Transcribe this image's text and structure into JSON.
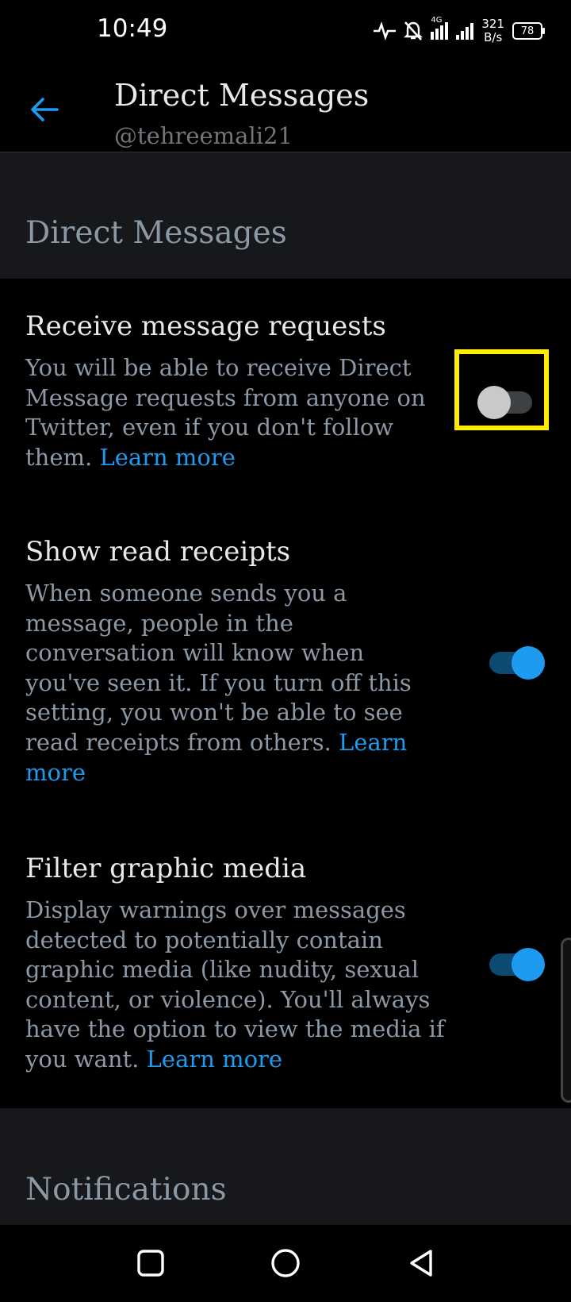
{
  "status_bar": {
    "time": "10:49",
    "net_speed_value": "321",
    "net_speed_unit": "B/s",
    "network_type": "4G",
    "battery": "78",
    "icons": [
      "activity-icon",
      "bell-off-icon",
      "signal-4g-icon",
      "signal-icon",
      "battery-icon"
    ]
  },
  "header": {
    "back_icon": "arrow-left-icon",
    "title": "Direct Messages",
    "subtitle": "@tehreemali21"
  },
  "sections": {
    "dm_label": "Direct Messages",
    "notifications_label": "Notifications"
  },
  "settings": [
    {
      "title": "Receive message requests",
      "description": "You will be able to receive Direct Message requests from anyone on Twitter, even if you don't follow them.",
      "link": "Learn more",
      "enabled": false
    },
    {
      "title": "Show read receipts",
      "description": "When someone sends you a message, people in the conversation will know when you've seen it. If you turn off this setting, you won't be able to see read receipts from others.",
      "link": "Learn more",
      "enabled": true
    },
    {
      "title": "Filter graphic media",
      "description": "Display warnings over messages detected to potentially contain graphic media (like nudity, sexual content, or violence). You'll always have the option to view the media if you want.",
      "link": "Learn more",
      "enabled": true
    }
  ],
  "colors": {
    "accent": "#1d9bf0",
    "highlight": "#ffee00",
    "section_bg": "#16181c"
  },
  "nav_bar": {
    "icons": [
      "recents-square-icon",
      "home-circle-icon",
      "back-triangle-icon"
    ]
  }
}
